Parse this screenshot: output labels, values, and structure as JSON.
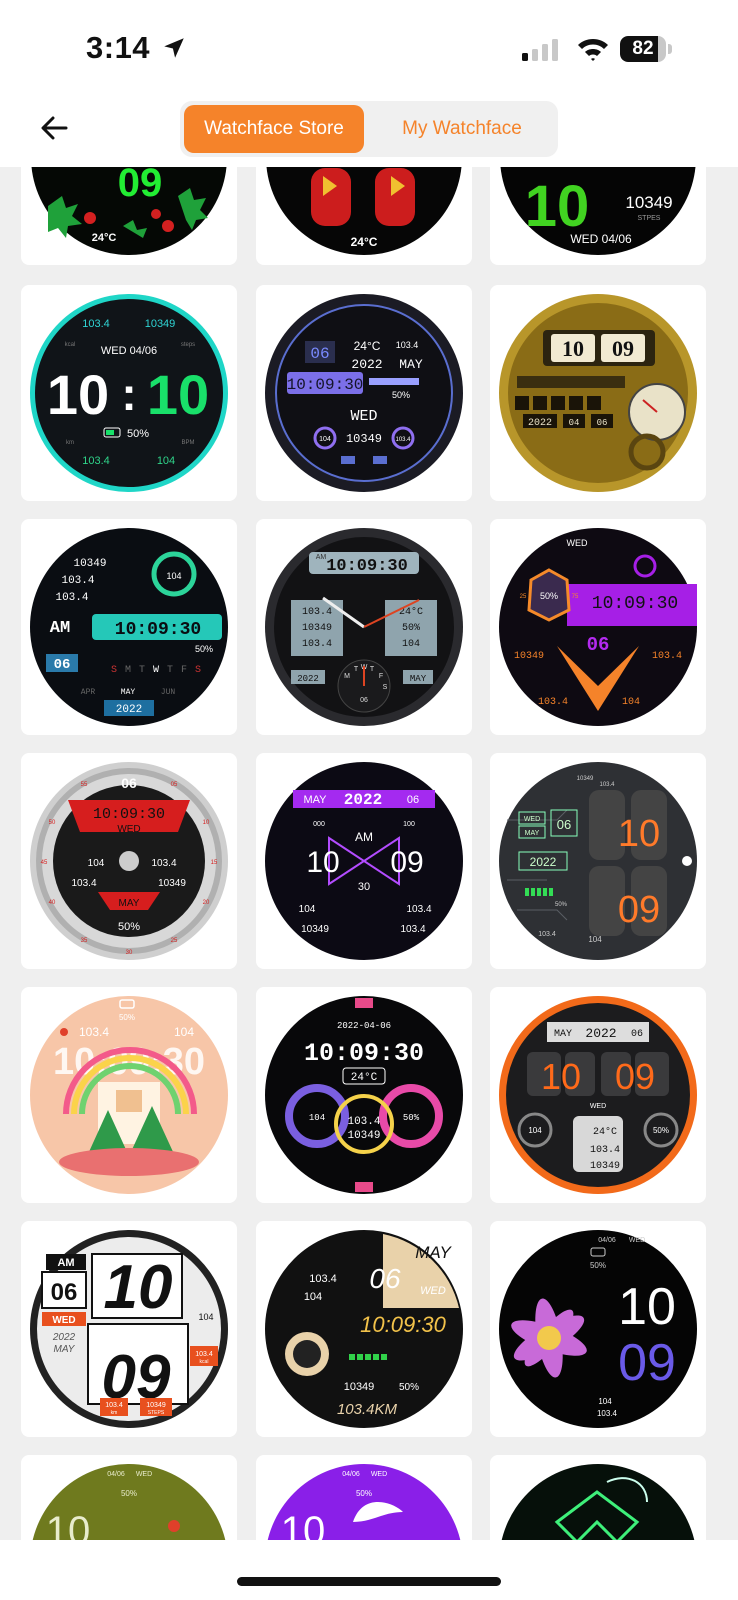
{
  "status_bar": {
    "time": "3:14",
    "battery": "82",
    "battery_level": 0.82
  },
  "header": {
    "back_icon": "arrow-left-icon",
    "tabs": [
      {
        "label": "Watchface Store",
        "active": true
      },
      {
        "label": "My Watchface",
        "active": false
      }
    ],
    "accent_color": "#f5832a"
  },
  "watchfaces": [
    {
      "id": "r0c0",
      "texts": [
        "09",
        "24°C"
      ]
    },
    {
      "id": "r0c1",
      "texts": [
        "24°C"
      ]
    },
    {
      "id": "r0c2",
      "texts": [
        "10",
        "10349",
        "STPES",
        "WED 04/06"
      ]
    },
    {
      "id": "r1c0",
      "texts": [
        "103.4",
        "10349",
        "kcal",
        "WED 04/06",
        "steps",
        "10",
        ":",
        "10",
        "50%",
        "km",
        "BPM",
        "103.4",
        "104"
      ]
    },
    {
      "id": "r1c1",
      "texts": [
        "24°C",
        "103.4",
        "06",
        "2022",
        "MAY",
        "10:09:30",
        "50%",
        "WED",
        "104",
        "10349",
        "103.4"
      ]
    },
    {
      "id": "r1c2",
      "texts": [
        "10",
        "09",
        "2022",
        "04",
        "06"
      ]
    },
    {
      "id": "r2c0",
      "texts": [
        "10349",
        "103.4",
        "103.4",
        "104",
        "AM",
        "10:09:30",
        "50%",
        "06",
        "S",
        "M",
        "T",
        "W",
        "T",
        "F",
        "S",
        "APR",
        "MAY",
        "JUN",
        "2022"
      ]
    },
    {
      "id": "r2c1",
      "texts": [
        "AM",
        "10:09:30",
        "103.4",
        "24°C",
        "10349",
        "50%",
        "103.4",
        "104",
        "2022",
        "MAY",
        "M",
        "T",
        "W",
        "T",
        "F",
        "S",
        "06"
      ]
    },
    {
      "id": "r2c2",
      "texts": [
        "WED",
        "50%",
        "25",
        "75",
        "10:09:30",
        "06",
        "10349",
        "103.4",
        "103.4",
        "104"
      ]
    },
    {
      "id": "r3c0",
      "texts": [
        "06",
        "10:09:30",
        "WED",
        "104",
        "103.4",
        "103.4",
        "10349",
        "MAY",
        "50%",
        "05",
        "10",
        "15",
        "20",
        "25",
        "30",
        "35",
        "40",
        "45",
        "50",
        "55"
      ]
    },
    {
      "id": "r3c1",
      "texts": [
        "MAY",
        "2022",
        "06",
        "000",
        "100",
        "AM",
        "10",
        "09",
        "30",
        "104",
        "103.4",
        "10349",
        "103.4"
      ]
    },
    {
      "id": "r3c2",
      "texts": [
        "10349",
        "103.4",
        "WED",
        "06",
        "MAY",
        "2022",
        "10",
        "09",
        "50%",
        "103.4",
        "104"
      ]
    },
    {
      "id": "r4c0",
      "texts": [
        "50%",
        "103.4",
        "104",
        "10:09:30"
      ]
    },
    {
      "id": "r4c1",
      "texts": [
        "2022-04-06",
        "10:09:30",
        "24°C",
        "104",
        "50%",
        "103.4",
        "10349"
      ]
    },
    {
      "id": "r4c2",
      "texts": [
        "MAY",
        "2022",
        "06",
        "10",
        "09",
        "WED",
        "104",
        "24°C",
        "50%",
        "103.4",
        "10349"
      ]
    },
    {
      "id": "r5c0",
      "texts": [
        "AM",
        "06",
        "10",
        "WED",
        "2022",
        "MAY",
        "09",
        "104",
        "103.4",
        "kcal",
        "103.4",
        "km",
        "10349",
        "STEPS"
      ]
    },
    {
      "id": "r5c1",
      "texts": [
        "MAY",
        "06",
        "WED",
        "103.4",
        "104",
        "10:09:30",
        "10349",
        "50%",
        "103.4KM"
      ]
    },
    {
      "id": "r5c2",
      "texts": [
        "04/06",
        "WED",
        "50%",
        "10",
        "09",
        "104",
        "103.4"
      ]
    },
    {
      "id": "r6c0",
      "texts": [
        "04/06",
        "WED",
        "50%",
        "10"
      ]
    },
    {
      "id": "r6c1",
      "texts": [
        "04/06",
        "WED",
        "50%",
        "10"
      ]
    },
    {
      "id": "r6c2",
      "texts": []
    }
  ]
}
